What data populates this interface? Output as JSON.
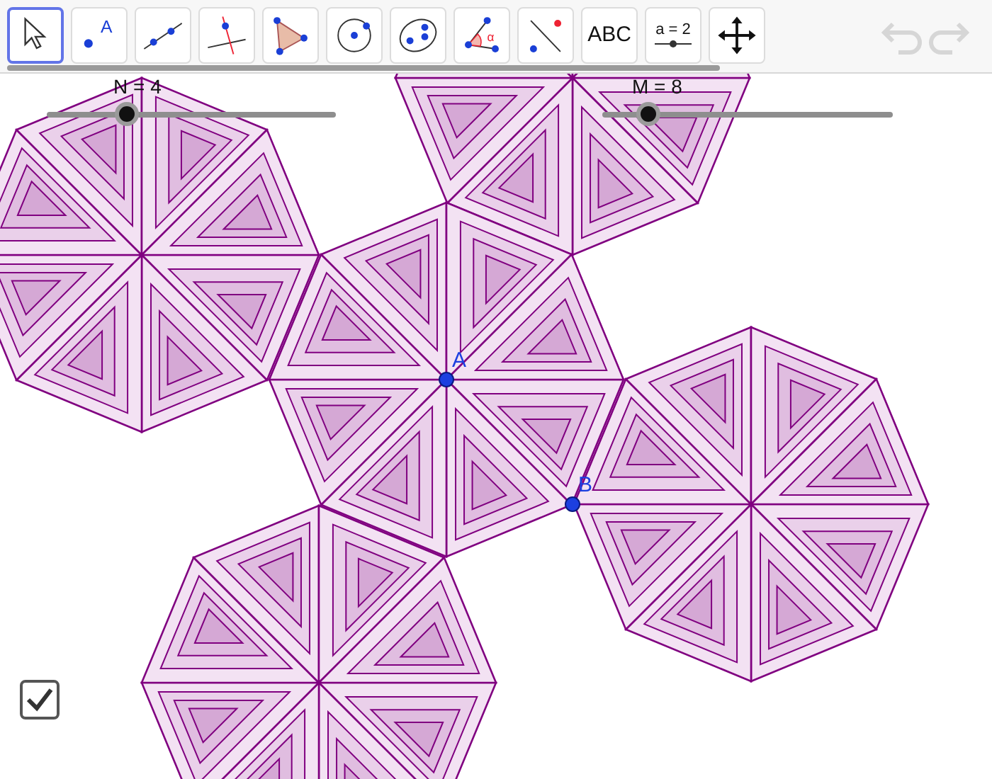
{
  "toolbar": {
    "tools": [
      {
        "kind": "move",
        "selected": true
      },
      {
        "kind": "point",
        "label": "A",
        "selected": false
      },
      {
        "kind": "line",
        "selected": false
      },
      {
        "kind": "perpendicular",
        "selected": false
      },
      {
        "kind": "polygon",
        "selected": false
      },
      {
        "kind": "circle",
        "selected": false
      },
      {
        "kind": "ellipse",
        "selected": false
      },
      {
        "kind": "angle",
        "label": "α",
        "selected": false
      },
      {
        "kind": "reflect",
        "selected": false
      },
      {
        "kind": "text",
        "label": "ABC",
        "selected": false
      },
      {
        "kind": "slider",
        "label": "a = 2",
        "selected": false
      },
      {
        "kind": "pan",
        "selected": false
      }
    ],
    "undo": {
      "disabled": true
    },
    "redo": {
      "disabled": true
    }
  },
  "sliders": [
    {
      "label": "N = 4",
      "level": 0.28
    },
    {
      "label": "M = 8",
      "level": 0.16
    }
  ],
  "points": [
    {
      "label": "A"
    },
    {
      "label": "B"
    }
  ],
  "checkbox": {
    "checked": true
  }
}
